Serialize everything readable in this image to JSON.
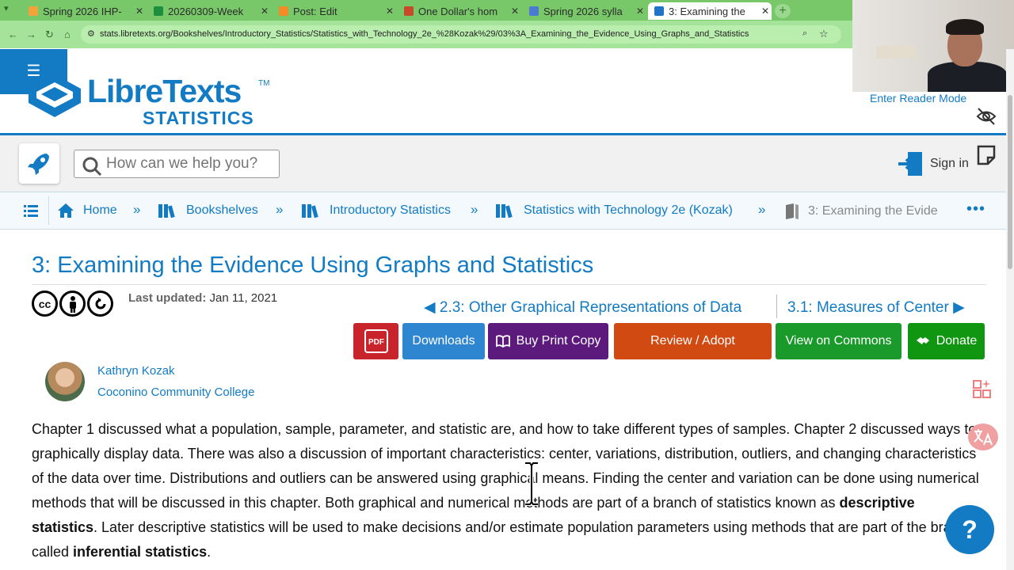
{
  "browser": {
    "tabs": [
      {
        "title": "Spring 2026 IHP-",
        "fav": "#f2a33a"
      },
      {
        "title": "20260309-Week",
        "fav": "#1e8e3e"
      },
      {
        "title": "Post: Edit",
        "fav": "#f28c28"
      },
      {
        "title": "One Dollar's hom",
        "fav": "#c74b2b"
      },
      {
        "title": "Spring 2026 sylla",
        "fav": "#4a7bd0"
      },
      {
        "title": "3: Examining the",
        "fav": "#1f74c7"
      }
    ],
    "new_tab": "+",
    "url": "stats.libretexts.org/Bookshelves/Introductory_Statistics/Statistics_with_Technology_2e_%28Kozak%29/03%3A_Examining_the_Evidence_Using_Graphs_and_Statistics"
  },
  "header": {
    "menu_glyph": "☰",
    "logo_main": "LibreTexts",
    "logo_tm": "TM",
    "logo_sub": "STATISTICS",
    "reader_mode": "Enter Reader Mode",
    "search_placeholder": "How can we help you?",
    "sign_in": "Sign in"
  },
  "breadcrumbs": [
    {
      "label": "Home",
      "icon": "home-icon"
    },
    {
      "label": "Bookshelves",
      "icon": "books-icon"
    },
    {
      "label": "Introductory Statistics",
      "icon": "books-icon"
    },
    {
      "label": "Statistics with Technology 2e (Kozak)",
      "icon": "books-icon"
    },
    {
      "label": "3: Examining the Evide",
      "icon": "book-icon"
    }
  ],
  "breadcrumb_sep": "»",
  "breadcrumb_more": "•••",
  "page": {
    "title": "3: Examining the Evidence Using Graphs and Statistics",
    "license_icons": [
      "cc",
      "by",
      "sa"
    ],
    "last_updated_label": "Last updated:",
    "last_updated_value": "Jan 11, 2021",
    "prev": "◀ 2.3: Other Graphical Representations of Data",
    "next": "3.1: Measures of Center ▶",
    "buttons": {
      "pdf": "PDF",
      "downloads": "Downloads",
      "print": "Buy Print Copy",
      "review": "Review / Adopt",
      "commons": "View on Commons",
      "donate": "Donate"
    },
    "author": {
      "name": "Kathryn Kozak",
      "institution": "Coconino Community College"
    },
    "paragraph": {
      "p1": "Chapter 1 discussed what a population, sample, parameter, and statistic are, and how to take different types of samples. Chapter 2 discussed ways to graphically display data. There was also a discussion of important characteristics: center, variations, distribution, outliers, and changing characteristics of the data over time. Distributions and outliers can be answered using graphical means. Finding the center and variation can be done using numerical methods that will be discussed in this chapter. Both graphical and numerical methods are part of a branch of statistics known as ",
      "b1": "descriptive statistics",
      "p2": ". Later descriptive statistics will be used to make decisions and/or estimate population parameters using methods that are part of the branch called ",
      "b2": "inferential statistics",
      "p3": "."
    },
    "help": "?"
  },
  "colors": {
    "brand": "#127bc4",
    "tab_bar": "#78c86a",
    "pdf": "#c9232b",
    "print": "#5c1a7d",
    "review": "#d04a12",
    "commons": "#1a9a2a",
    "donate": "#119611"
  }
}
